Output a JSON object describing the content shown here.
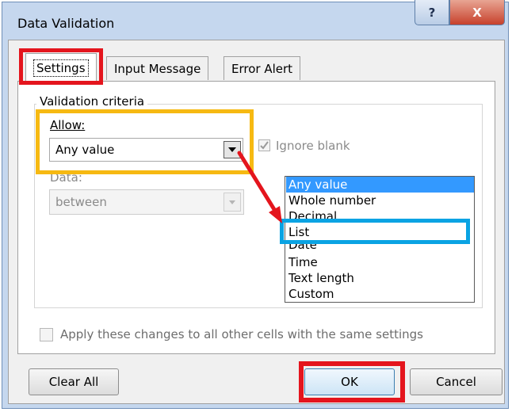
{
  "window": {
    "title": "Data Validation",
    "help_label": "?",
    "close_label": "X"
  },
  "tabs": [
    {
      "label": "Settings",
      "selected": true
    },
    {
      "label": "Input Message",
      "selected": false
    },
    {
      "label": "Error Alert",
      "selected": false
    }
  ],
  "settings": {
    "group_label": "Validation criteria",
    "allow_label": "Allow:",
    "allow_value": "Any value",
    "ignore_blank_label": "Ignore blank",
    "ignore_blank_checked": true,
    "data_label": "Data:",
    "data_value": "between",
    "apply_all_label": "Apply these changes to all other cells with the same settings",
    "apply_all_checked": false
  },
  "dropdown": {
    "items": [
      "Any value",
      "Whole number",
      "Decimal",
      "List",
      "Date",
      "Time",
      "Text length",
      "Custom"
    ],
    "selected": "Any value"
  },
  "buttons": {
    "clear_all": "Clear All",
    "ok": "OK",
    "cancel": "Cancel"
  },
  "icons": {
    "help": "help-icon",
    "close": "close-icon",
    "dropdown_arrow": "chevron-down-icon",
    "checkmark": "check-icon"
  },
  "colors": {
    "annotation_red": "#e4151d",
    "annotation_yellow": "#f6b912",
    "annotation_blue": "#0aa3e3",
    "selection_blue": "#3399ff"
  }
}
